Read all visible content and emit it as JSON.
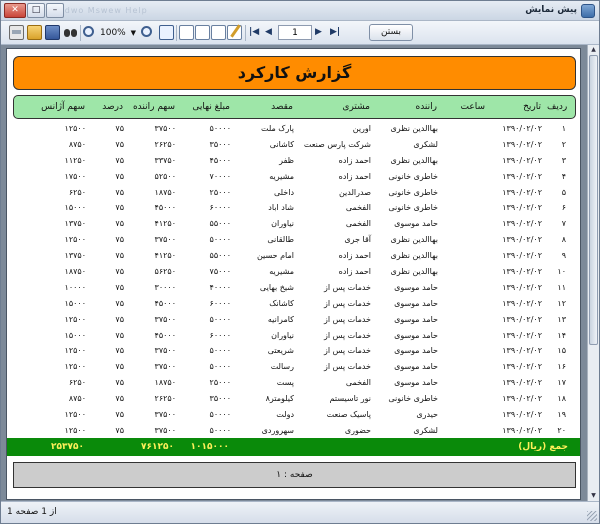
{
  "window": {
    "title": "پیش نمایش",
    "faded_menu": "Fle  Ldwo   Mswew   Help"
  },
  "toolbar": {
    "zoom": "100%",
    "page_value": "1",
    "close_label": "بستن"
  },
  "report": {
    "title": "گزارش کارکرد",
    "columns": {
      "idx": "ردیف",
      "date": "تاریخ",
      "time": "ساعت",
      "driver": "راننده",
      "customer": "مشتری",
      "destination": "مقصد",
      "amount": "مبلغ نهایی",
      "driver_share": "سهم راننده",
      "percent": "درصد",
      "agency_share": "سهم آژانس"
    },
    "rows": [
      {
        "idx": "۱",
        "date": "۱۳۹۰/۰۲/۰۲",
        "time": "",
        "driver": "بهاالدین نظری",
        "customer": "اورین",
        "destination": "پارک ملت",
        "amount": "۵۰۰۰۰",
        "driver_share": "۳۷۵۰۰",
        "percent": "۷۵",
        "agency_share": "۱۲۵۰۰"
      },
      {
        "idx": "۲",
        "date": "۱۳۹۰/۰۲/۰۲",
        "time": "",
        "driver": "لشکری",
        "customer": "شرکت پارس صنعت",
        "destination": "کاشانی",
        "amount": "۳۵۰۰۰",
        "driver_share": "۲۶۲۵۰",
        "percent": "۷۵",
        "agency_share": "۸۷۵۰"
      },
      {
        "idx": "۳",
        "date": "۱۳۹۰/۰۲/۰۲",
        "time": "",
        "driver": "بهاالدین نظری",
        "customer": "احمد زاده",
        "destination": "ظفر",
        "amount": "۴۵۰۰۰",
        "driver_share": "۳۳۷۵۰",
        "percent": "۷۵",
        "agency_share": "۱۱۲۵۰"
      },
      {
        "idx": "۴",
        "date": "۱۳۹۰/۰۲/۰۲",
        "time": "",
        "driver": "خاطری خانونی",
        "customer": "احمد زاده",
        "destination": "مشیریه",
        "amount": "۷۰۰۰۰",
        "driver_share": "۵۲۵۰۰",
        "percent": "۷۵",
        "agency_share": "۱۷۵۰۰"
      },
      {
        "idx": "۵",
        "date": "۱۳۹۰/۰۲/۰۲",
        "time": "",
        "driver": "خاطری خانونی",
        "customer": "صدرالدین",
        "destination": "داخلی",
        "amount": "۲۵۰۰۰",
        "driver_share": "۱۸۷۵۰",
        "percent": "۷۵",
        "agency_share": "۶۲۵۰"
      },
      {
        "idx": "۶",
        "date": "۱۳۹۰/۰۲/۰۲",
        "time": "",
        "driver": "خاطری خانونی",
        "customer": "الفخمی",
        "destination": "شاد اباد",
        "amount": "۶۰۰۰۰",
        "driver_share": "۴۵۰۰۰",
        "percent": "۷۵",
        "agency_share": "۱۵۰۰۰"
      },
      {
        "idx": "۷",
        "date": "۱۳۹۰/۰۲/۰۲",
        "time": "",
        "driver": "حامد موسوی",
        "customer": "الفخمی",
        "destination": "نیاوران",
        "amount": "۵۵۰۰۰",
        "driver_share": "۴۱۲۵۰",
        "percent": "۷۵",
        "agency_share": "۱۳۷۵۰"
      },
      {
        "idx": "۸",
        "date": "۱۳۹۰/۰۲/۰۲",
        "time": "",
        "driver": "بهاالدین نظری",
        "customer": "آقا جری",
        "destination": "طالقانی",
        "amount": "۵۰۰۰۰",
        "driver_share": "۳۷۵۰۰",
        "percent": "۷۵",
        "agency_share": "۱۲۵۰۰"
      },
      {
        "idx": "۹",
        "date": "۱۳۹۰/۰۲/۰۲",
        "time": "",
        "driver": "بهاالدین نظری",
        "customer": "احمد زاده",
        "destination": "امام حسین",
        "amount": "۵۵۰۰۰",
        "driver_share": "۴۱۲۵۰",
        "percent": "۷۵",
        "agency_share": "۱۳۷۵۰"
      },
      {
        "idx": "۱۰",
        "date": "۱۳۹۰/۰۲/۰۲",
        "time": "",
        "driver": "بهاالدین نظری",
        "customer": "احمد زاده",
        "destination": "مشیریه",
        "amount": "۷۵۰۰۰",
        "driver_share": "۵۶۲۵۰",
        "percent": "۷۵",
        "agency_share": "۱۸۷۵۰"
      },
      {
        "idx": "۱۱",
        "date": "۱۳۹۰/۰۲/۰۲",
        "time": "",
        "driver": "حامد موسوی",
        "customer": "خدمات پس از",
        "destination": "شیخ بهایی",
        "amount": "۴۰۰۰۰",
        "driver_share": "۳۰۰۰۰",
        "percent": "۷۵",
        "agency_share": "۱۰۰۰۰"
      },
      {
        "idx": "۱۲",
        "date": "۱۳۹۰/۰۲/۰۲",
        "time": "",
        "driver": "حامد موسوی",
        "customer": "خدمات پس از",
        "destination": "کاشانک",
        "amount": "۶۰۰۰۰",
        "driver_share": "۴۵۰۰۰",
        "percent": "۷۵",
        "agency_share": "۱۵۰۰۰"
      },
      {
        "idx": "۱۳",
        "date": "۱۳۹۰/۰۲/۰۲",
        "time": "",
        "driver": "حامد موسوی",
        "customer": "خدمات پس از",
        "destination": "کامرانیه",
        "amount": "۵۰۰۰۰",
        "driver_share": "۳۷۵۰۰",
        "percent": "۷۵",
        "agency_share": "۱۲۵۰۰"
      },
      {
        "idx": "۱۴",
        "date": "۱۳۹۰/۰۲/۰۲",
        "time": "",
        "driver": "حامد موسوی",
        "customer": "خدمات پس از",
        "destination": "نیاوران",
        "amount": "۶۰۰۰۰",
        "driver_share": "۴۵۰۰۰",
        "percent": "۷۵",
        "agency_share": "۱۵۰۰۰"
      },
      {
        "idx": "۱۵",
        "date": "۱۳۹۰/۰۲/۰۲",
        "time": "",
        "driver": "حامد موسوی",
        "customer": "خدمات پس از",
        "destination": "شریعتی",
        "amount": "۵۰۰۰۰",
        "driver_share": "۳۷۵۰۰",
        "percent": "۷۵",
        "agency_share": "۱۲۵۰۰"
      },
      {
        "idx": "۱۶",
        "date": "۱۳۹۰/۰۲/۰۲",
        "time": "",
        "driver": "حامد موسوی",
        "customer": "خدمات پس از",
        "destination": "رسالت",
        "amount": "۵۰۰۰۰",
        "driver_share": "۳۷۵۰۰",
        "percent": "۷۵",
        "agency_share": "۱۲۵۰۰"
      },
      {
        "idx": "۱۷",
        "date": "۱۳۹۰/۰۲/۰۲",
        "time": "",
        "driver": "حامد موسوی",
        "customer": "الفخمی",
        "destination": "پست",
        "amount": "۲۵۰۰۰",
        "driver_share": "۱۸۷۵۰",
        "percent": "۷۵",
        "agency_share": "۶۲۵۰"
      },
      {
        "idx": "۱۸",
        "date": "۱۳۹۰/۰۲/۰۲",
        "time": "",
        "driver": "خاطری خانونی",
        "customer": "نور تاسیستم",
        "destination": "کیلومتر۸",
        "amount": "۳۵۰۰۰",
        "driver_share": "۲۶۲۵۰",
        "percent": "۷۵",
        "agency_share": "۸۷۵۰"
      },
      {
        "idx": "۱۹",
        "date": "۱۳۹۰/۰۲/۰۲",
        "time": "",
        "driver": "حیدری",
        "customer": "پاسیک صنعت",
        "destination": "دولت",
        "amount": "۵۰۰۰۰",
        "driver_share": "۳۷۵۰۰",
        "percent": "۷۵",
        "agency_share": "۱۲۵۰۰"
      },
      {
        "idx": "۲۰",
        "date": "۱۳۹۰/۰۲/۰۲",
        "time": "",
        "driver": "لشکری",
        "customer": "حضوری",
        "destination": "سهروردی",
        "amount": "۵۰۰۰۰",
        "driver_share": "۳۷۵۰۰",
        "percent": "۷۵",
        "agency_share": "۱۲۵۰۰"
      }
    ],
    "totals": {
      "label": "جمع (ریال)",
      "amount": "۱۰۱۵۰۰۰",
      "driver_share": "۷۶۱۲۵۰",
      "agency_share": "۲۵۳۷۵۰"
    },
    "footer": "صفحه :   ۱"
  },
  "status": {
    "text": "از 1 صفحه 1"
  },
  "colors": {
    "title_bg": "#ff8c00",
    "header_bg": "#9ee6a8",
    "total_bg": "#0a8a0a",
    "total_text": "#fff05a",
    "footer_bg": "#cccccc"
  }
}
